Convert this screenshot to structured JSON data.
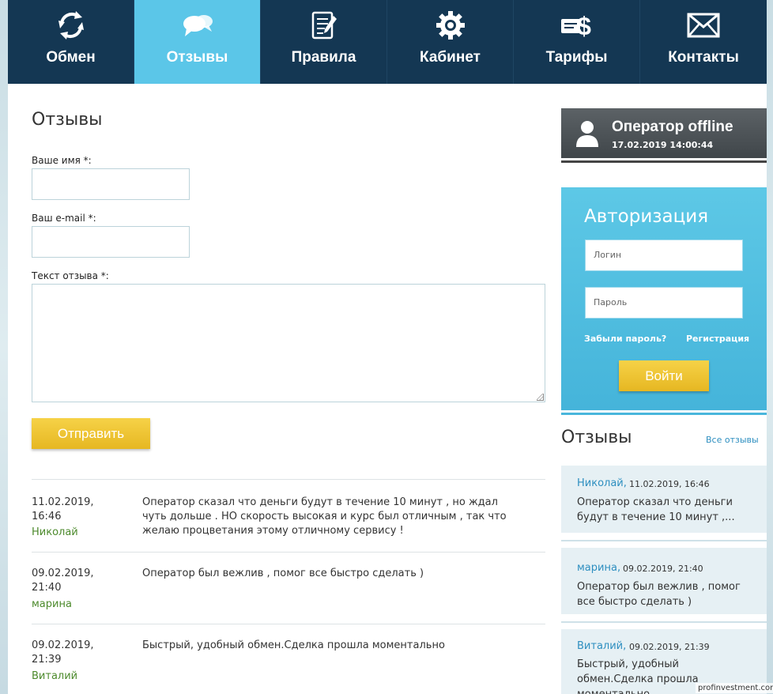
{
  "nav": [
    {
      "label": "Обмен",
      "icon": "refresh-icon",
      "active": false
    },
    {
      "label": "Отзывы",
      "icon": "chat-bubbles-icon",
      "active": true
    },
    {
      "label": "Правила",
      "icon": "document-pen-icon",
      "active": false
    },
    {
      "label": "Кабинет",
      "icon": "gear-icon",
      "active": false
    },
    {
      "label": "Тарифы",
      "icon": "money-dollar-icon",
      "active": false
    },
    {
      "label": "Контакты",
      "icon": "envelope-icon",
      "active": false
    }
  ],
  "colors": {
    "nav_bg": "#143753",
    "nav_active": "#5bc6e8",
    "button_yellow": "#f0c531",
    "author_green": "#4c8a2c",
    "link_blue": "#2e8fc0"
  },
  "form": {
    "title": "Отзывы",
    "name_label": "Ваше имя *:",
    "email_label": "Ваш e-mail *:",
    "text_label": "Текст отзыва *:",
    "name_value": "",
    "email_value": "",
    "text_value": "",
    "submit_label": "Отправить"
  },
  "reviews": [
    {
      "date": "11.02.2019,",
      "time": "16:46",
      "author": "Николай",
      "text": "Оператор сказал что деньги будут в течение 10 минут , но ждал чуть дольше . НО скорость высокая и курс был отличным , так что желаю процветания этому отличному сервису !"
    },
    {
      "date": "09.02.2019,",
      "time": "21:40",
      "author": "марина",
      "text": "Оператор был вежлив , помог все быстро сделать )"
    },
    {
      "date": "09.02.2019,",
      "time": "21:39",
      "author": "Виталий",
      "text": "Быстрый, удобный обмен.Сделка прошла моментально"
    }
  ],
  "operator": {
    "status": "Оператор offline",
    "datetime": "17.02.2019 14:00:44"
  },
  "auth": {
    "title": "Авторизация",
    "login_placeholder": "Логин",
    "password_placeholder": "Пароль",
    "forgot_label": "Забыли пароль?",
    "register_label": "Регистрация",
    "login_button": "Войти"
  },
  "sidebar_reviews": {
    "title": "Отзывы",
    "all_link": "Все отзывы",
    "items": [
      {
        "name": "Николай,",
        "date": "11.02.2019, 16:46",
        "text": "Оператор сказал что деньги будут в течение 10 минут ,..."
      },
      {
        "name": "марина,",
        "date": "09.02.2019, 21:40",
        "text": "Оператор был вежлив , помог все быстро сделать )"
      },
      {
        "name": "Виталий,",
        "date": "09.02.2019, 21:39",
        "text": "Быстрый, удобный обмен.Сделка прошла моментально"
      }
    ]
  },
  "watermark": "profinvestment.com"
}
